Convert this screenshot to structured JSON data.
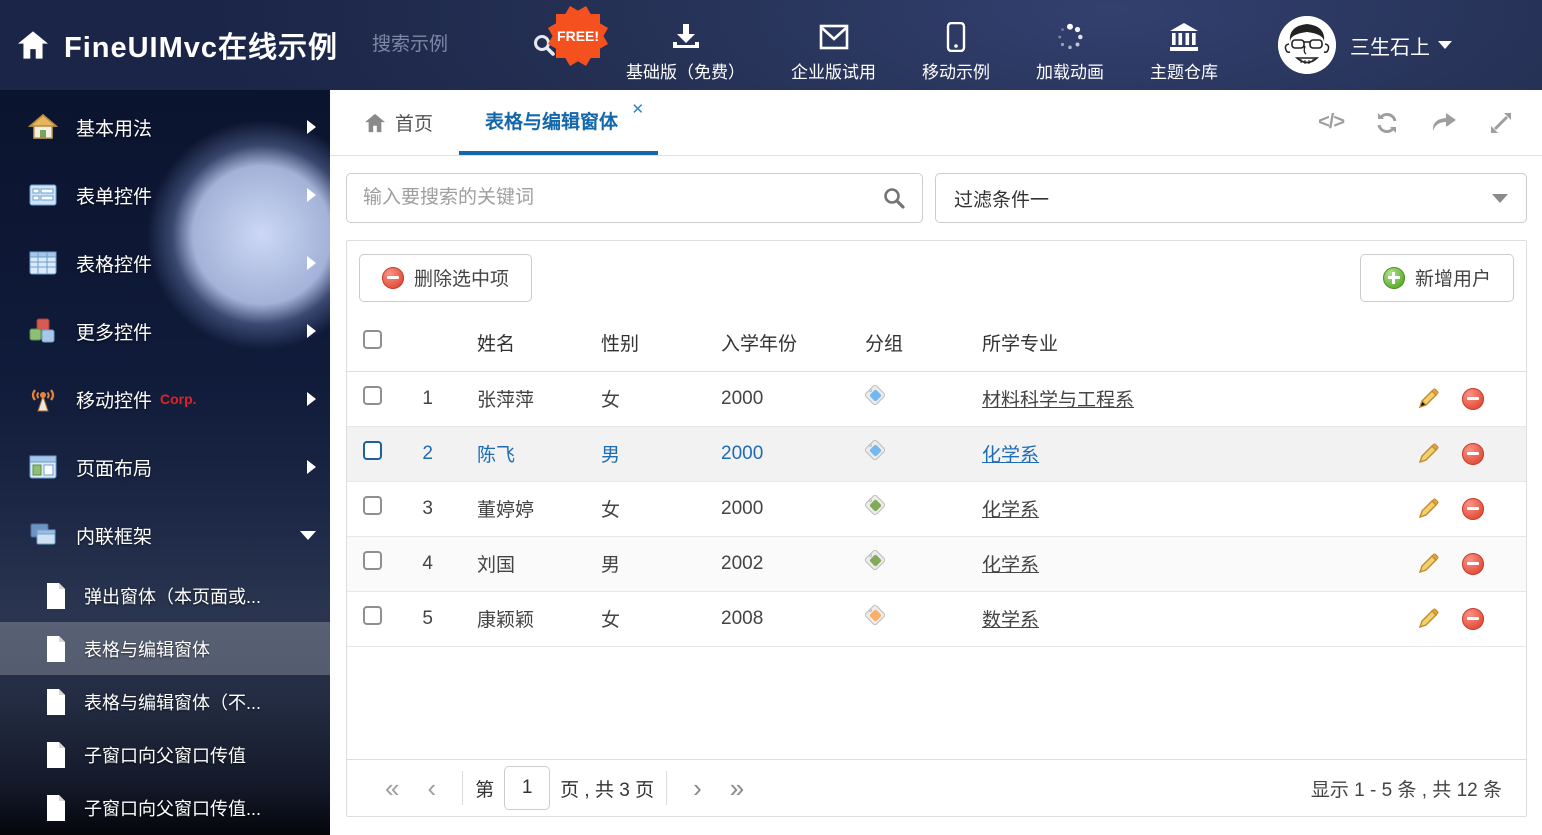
{
  "header": {
    "title": "FineUIMvc在线示例",
    "search_placeholder": "搜索示例",
    "free_badge": "FREE!",
    "nav": [
      {
        "label": "基础版（免费）",
        "icon": "download-icon"
      },
      {
        "label": "企业版试用",
        "icon": "envelope-icon"
      },
      {
        "label": "移动示例",
        "icon": "mobile-icon"
      },
      {
        "label": "加载动画",
        "icon": "spinner-icon"
      },
      {
        "label": "主题仓库",
        "icon": "bank-icon"
      }
    ],
    "username": "三生石上"
  },
  "sidebar": {
    "items": [
      {
        "label": "基本用法"
      },
      {
        "label": "表单控件"
      },
      {
        "label": "表格控件"
      },
      {
        "label": "更多控件"
      },
      {
        "label": "移动控件",
        "badge": "Corp."
      },
      {
        "label": "页面布局"
      },
      {
        "label": "内联框架"
      }
    ],
    "subitems": [
      {
        "label": "弹出窗体（本页面或..."
      },
      {
        "label": "表格与编辑窗体"
      },
      {
        "label": "表格与编辑窗体（不..."
      },
      {
        "label": "子窗口向父窗口传值"
      },
      {
        "label": "子窗口向父窗口传值..."
      }
    ]
  },
  "tabs": {
    "home": "首页",
    "active": "表格与编辑窗体"
  },
  "filter": {
    "search_placeholder": "输入要搜索的关键词",
    "filter_value": "过滤条件一"
  },
  "toolbar": {
    "delete_label": "删除选中项",
    "add_label": "新增用户"
  },
  "table": {
    "columns": [
      "姓名",
      "性别",
      "入学年份",
      "分组",
      "所学专业"
    ],
    "rows": [
      {
        "num": "1",
        "name": "张萍萍",
        "gender": "女",
        "year": "2000",
        "tag": "blue-tag",
        "tag_hex": "#73b8f0",
        "major": "材料科学与工程系"
      },
      {
        "num": "2",
        "name": "陈飞",
        "gender": "男",
        "year": "2000",
        "tag": "blue-tag",
        "tag_hex": "#73b8f0",
        "major": "化学系"
      },
      {
        "num": "3",
        "name": "董婷婷",
        "gender": "女",
        "year": "2000",
        "tag": "green-tag",
        "tag_hex": "#82aa5b",
        "major": "化学系"
      },
      {
        "num": "4",
        "name": "刘国",
        "gender": "男",
        "year": "2002",
        "tag": "green-tag",
        "tag_hex": "#82aa5b",
        "major": "化学系"
      },
      {
        "num": "5",
        "name": "康颖颖",
        "gender": "女",
        "year": "2008",
        "tag": "orange-tag",
        "tag_hex": "#f7b06a",
        "major": "数学系"
      }
    ]
  },
  "pager": {
    "first": "«",
    "prev": "‹",
    "page_prefix": "第",
    "page": "1",
    "page_suffix": "页 , 共 3 页",
    "next": "›",
    "last": "»",
    "summary": "显示 1 - 5 条 , 共 12 条"
  },
  "colors": {
    "accent_blue": "#1467a8",
    "danger_red": "#e2503c",
    "success_green": "#5fae33",
    "badge_orange": "#f4511e"
  }
}
